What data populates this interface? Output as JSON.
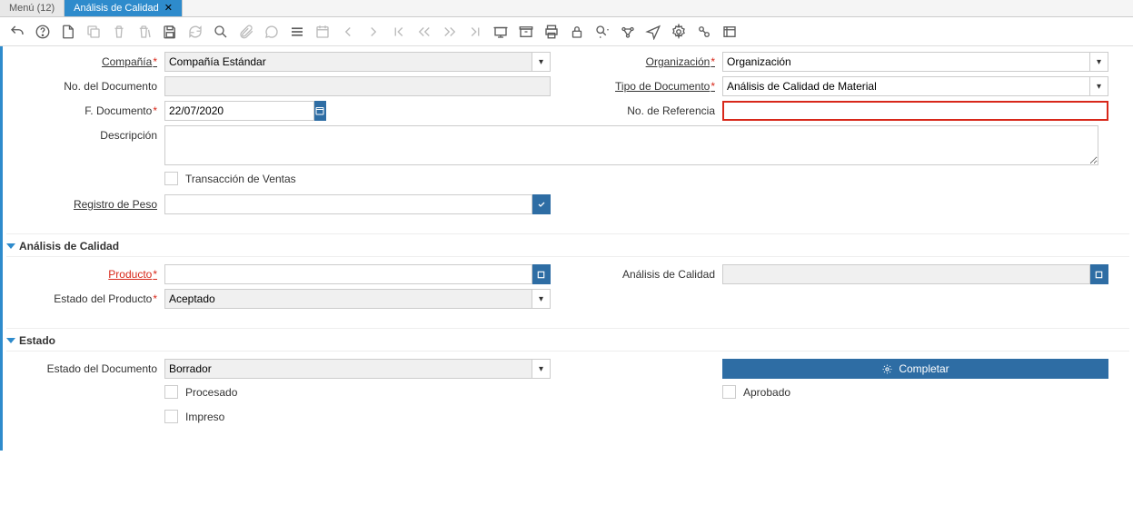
{
  "tabs": {
    "menu": "Menú (12)",
    "active": "Análisis de Calidad"
  },
  "labels": {
    "compania": "Compañía",
    "organizacion": "Organización",
    "no_documento": "No. del Documento",
    "tipo_documento": "Tipo de Documento",
    "f_documento": "F. Documento",
    "no_referencia": "No. de Referencia",
    "descripcion": "Descripción",
    "transaccion_ventas": "Transacción de Ventas",
    "registro_peso": "Registro de Peso",
    "producto": "Producto",
    "analisis_calidad": "Análisis de Calidad",
    "estado_producto": "Estado del Producto",
    "estado_documento": "Estado del Documento",
    "procesado": "Procesado",
    "aprobado": "Aprobado",
    "impreso": "Impreso"
  },
  "sections": {
    "analisis_calidad": "Análisis de Calidad",
    "estado": "Estado"
  },
  "values": {
    "compania": "Compañía Estándar",
    "organizacion": "Organización",
    "no_documento": "",
    "tipo_documento": "Análisis de Calidad de Material",
    "f_documento": "22/07/2020",
    "no_referencia": "",
    "descripcion": "",
    "registro_peso": "",
    "producto": "",
    "analisis_calidad": "",
    "estado_producto": "Aceptado",
    "estado_documento": "Borrador"
  },
  "buttons": {
    "completar": "Completar"
  }
}
